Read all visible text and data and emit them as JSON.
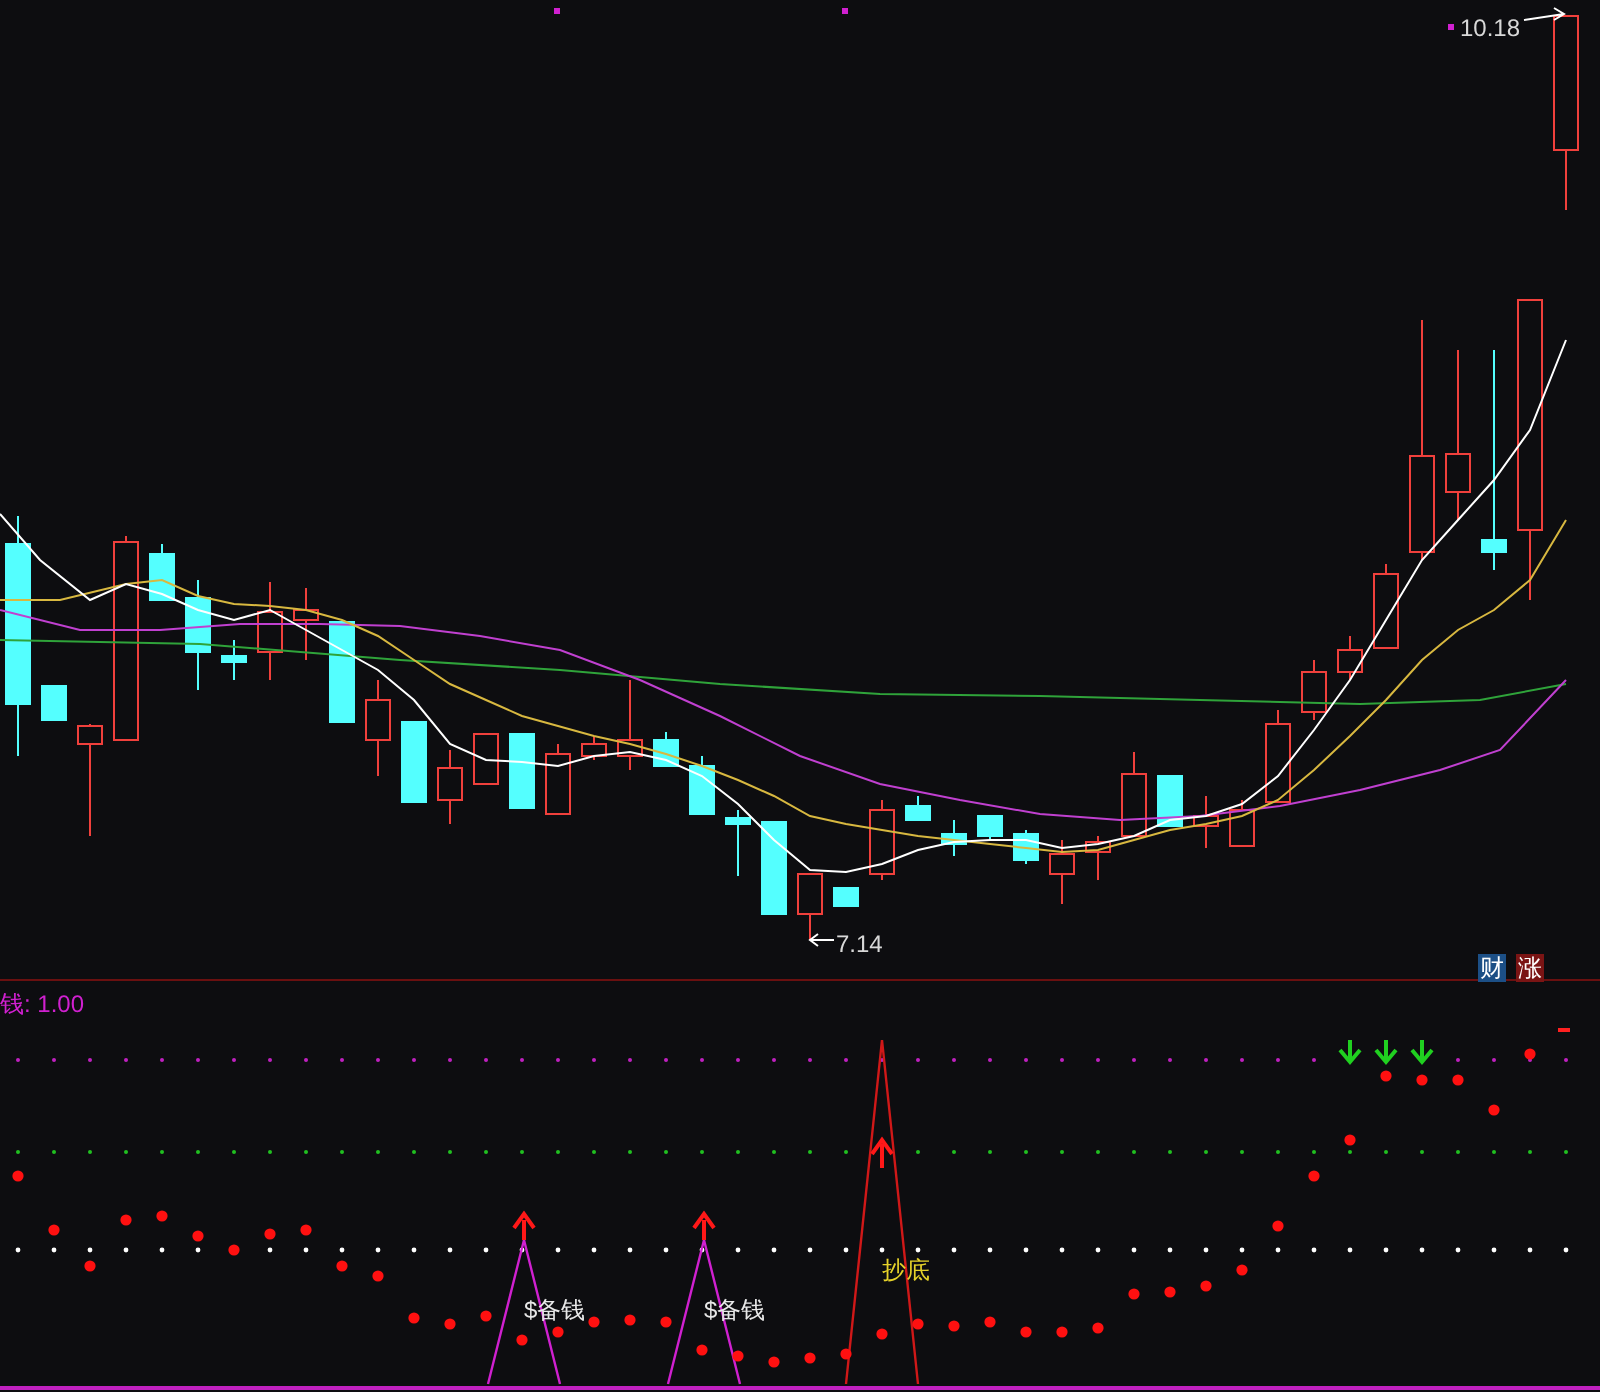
{
  "price_chart": {
    "high_label": "10.18",
    "low_label": "7.14",
    "badges": [
      {
        "text": "财",
        "color": "#1c4f86"
      },
      {
        "text": "涨",
        "color": "#7a1414"
      }
    ]
  },
  "indicator": {
    "title": "钱: 1.00",
    "signals": [
      {
        "kind": "money",
        "text": "$备钱"
      },
      {
        "kind": "money",
        "text": "$备钱"
      },
      {
        "kind": "bottom",
        "text": "抄底"
      }
    ]
  }
}
